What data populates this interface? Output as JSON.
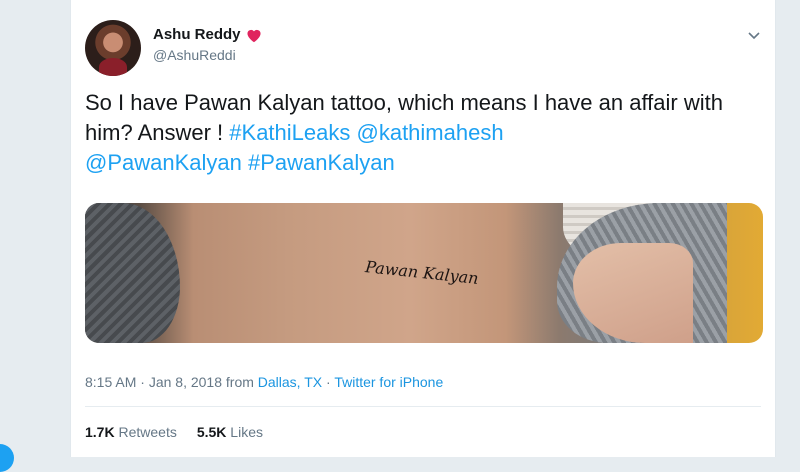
{
  "author": {
    "display_name": "Ashu Reddy",
    "handle": "@AshuReddi"
  },
  "tweet": {
    "text_plain": "So I have Pawan Kalyan tattoo, which means I have an affair with him? Answer ! ",
    "hashtag_1": "#KathiLeaks",
    "mention_1": "@kathimahesh",
    "mention_2": "@PawanKalyan",
    "hashtag_2": "#PawanKalyan"
  },
  "media": {
    "tattoo_text": "Pawan Kalyan"
  },
  "meta": {
    "time": "8:15 AM",
    "date": "Jan 8, 2018",
    "from_label": "from",
    "location": "Dallas, TX",
    "source": "Twitter for iPhone"
  },
  "stats": {
    "retweets_count": "1.7K",
    "retweets_label": "Retweets",
    "likes_count": "5.5K",
    "likes_label": "Likes"
  },
  "colors": {
    "link": "#1da1f2",
    "heart": "#e0245e",
    "muted": "#657786"
  },
  "icons": [
    "heart-icon",
    "chevron-down-icon"
  ]
}
